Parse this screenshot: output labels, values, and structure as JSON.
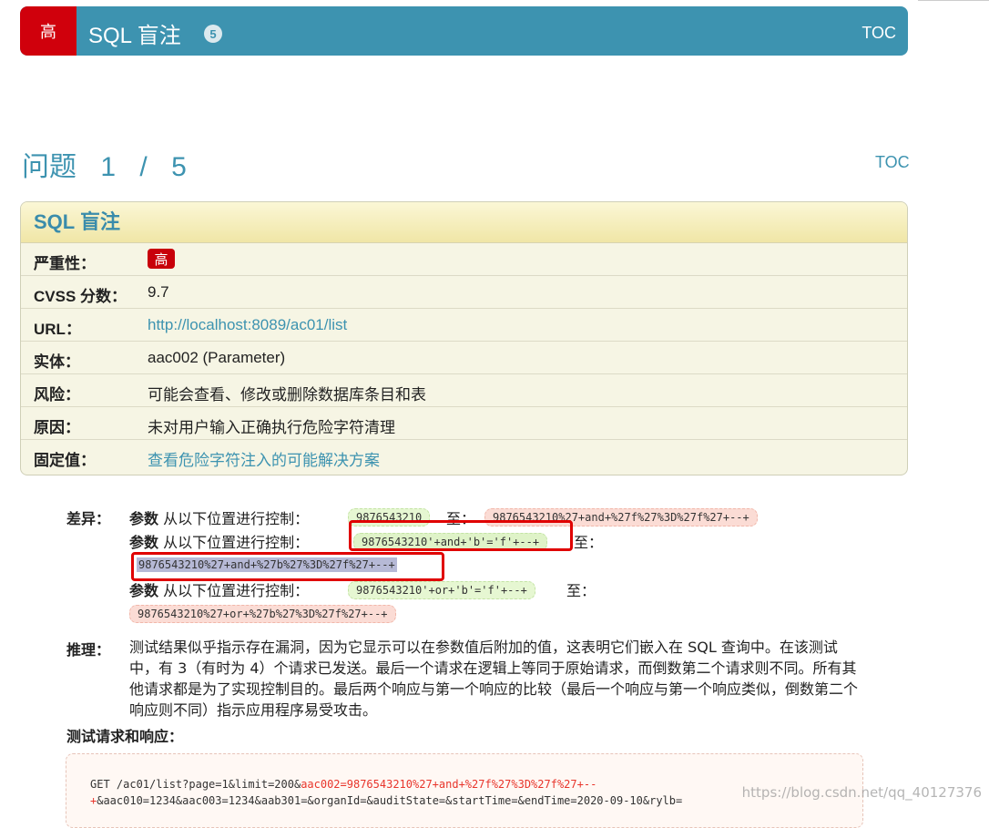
{
  "header": {
    "severity_glyph": "高",
    "title": "SQL 盲注",
    "count": "5",
    "toc": "TOC"
  },
  "issue": {
    "label": "问题",
    "current": "1",
    "sep": "/",
    "total": "5",
    "toc": "TOC"
  },
  "details": {
    "title": "SQL 盲注",
    "rows": [
      {
        "key": "严重性：",
        "value": "高"
      },
      {
        "key": "CVSS 分数：",
        "value": "9.7"
      },
      {
        "key": "URL：",
        "value": "http://localhost:8089/ac01/list"
      },
      {
        "key": "实体：",
        "value": "aac002 (Parameter)"
      },
      {
        "key": "风险：",
        "value": "可能会查看、修改或删除数据库条目和表"
      },
      {
        "key": "原因：",
        "value": "未对用户输入正确执行危险字符清理"
      },
      {
        "key": "固定值：",
        "value": "查看危险字符注入的可能解决方案"
      }
    ]
  },
  "diff": {
    "label": "差异：",
    "param": "参数",
    "control": "从以下位置进行控制：",
    "to": "至：",
    "to2": "至：",
    "rows": [
      {
        "from": "9876543210",
        "to": "9876543210%27+and+%27f%27%3D%27f%27+--+"
      },
      {
        "from": "9876543210'+and+'b'='f'+--+",
        "to": "9876543210%27+and+%27b%27%3D%27f%27+--+"
      },
      {
        "from": "9876543210'+or+'b'='f'+--+",
        "to": "9876543210%27+or+%27b%27%3D%27f%27+--+"
      }
    ]
  },
  "reasoning": {
    "label": "推理：",
    "text": "测试结果似乎指示存在漏洞，因为它显示可以在参数值后附加的值，这表明它们嵌入在 SQL 查询中。在该测试中，有 3（有时为 4）个请求已发送。最后一个请求在逻辑上等同于原始请求，而倒数第二个请求则不同。所有其他请求都是为了实现控制目的。最后两个响应与第一个响应的比较（最后一个响应与第一个响应类似，倒数第二个响应则不同）指示应用程序易受攻击。"
  },
  "test": {
    "label": "测试请求和响应：",
    "line1_prefix": "GET /ac01/list?page=1&limit=200&",
    "line1_highlight": "aac002=9876543210%27+and+%27f%27%3D%27f%27+--",
    "line2_highlight": "+",
    "line2_rest": "&aac010=1234&aac003=1234&aab301=&organId=&auditState=&startTime=&endTime=2020-09-10&rylb="
  },
  "watermark": "https://blog.csdn.net/qq_40127376"
}
